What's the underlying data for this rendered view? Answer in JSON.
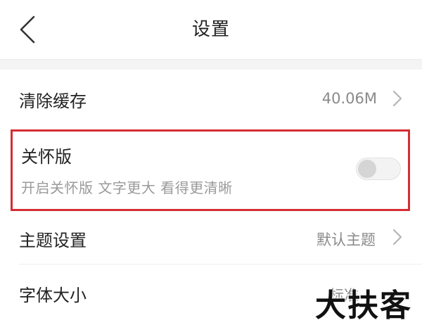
{
  "header": {
    "title": "设置"
  },
  "settings": {
    "clear_cache": {
      "label": "清除缓存",
      "value": "40.06M"
    },
    "care_mode": {
      "label": "关怀版",
      "subtitle": "开启关怀版 文字更大 看得更清晰",
      "enabled": false
    },
    "theme": {
      "label": "主题设置",
      "value": "默认主题"
    },
    "font_size": {
      "label": "字体大小",
      "value": "标准"
    }
  },
  "watermark": "大扶客",
  "colors": {
    "highlight_border": "#d42d33",
    "text_primary": "#222222",
    "text_secondary": "#8a8a8a",
    "toggle_off": "#d5d5d5"
  }
}
